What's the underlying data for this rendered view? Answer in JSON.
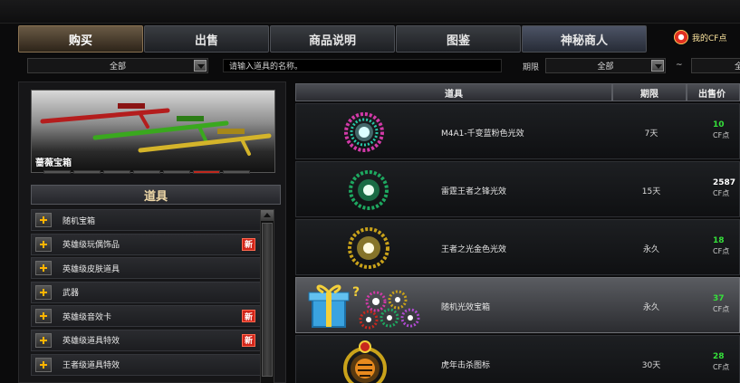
{
  "tabs": [
    {
      "label": "购买",
      "active": true
    },
    {
      "label": "出售",
      "active": false
    },
    {
      "label": "商品说明",
      "active": false
    },
    {
      "label": "图鉴",
      "active": false
    },
    {
      "label": "神秘商人",
      "active": false
    }
  ],
  "header": {
    "my_cf_label": "我的CF点"
  },
  "filter": {
    "category_value": "全部",
    "search_placeholder": "请输入道具的名称。",
    "period_label": "期限",
    "period_value": "全部",
    "tilde": "~",
    "price_value": "全"
  },
  "banner": {
    "label": "蔷薇宝箱",
    "page_count": 7,
    "active_page": 6
  },
  "sidebar": {
    "header": "道具",
    "items": [
      {
        "label": "随机宝箱",
        "new": false
      },
      {
        "label": "英雄级玩偶饰品",
        "new": true
      },
      {
        "label": "英雄级皮肤道具",
        "new": false
      },
      {
        "label": "武器",
        "new": false
      },
      {
        "label": "英雄级音效卡",
        "new": true
      },
      {
        "label": "英雄级道具特效",
        "new": true
      },
      {
        "label": "王者级道具特效",
        "new": false
      }
    ],
    "new_badge": "新"
  },
  "table": {
    "columns": [
      "道具",
      "期限",
      "出售价"
    ],
    "rows": [
      {
        "name": "M4A1-千变蓝粉色光效",
        "period": "7天",
        "price": "10",
        "unit": "CF点",
        "icon": "pink-teal-ring-effect-icon",
        "price_color": "#35e03a"
      },
      {
        "name": "雷霆王者之锋光效",
        "period": "15天",
        "price": "2587",
        "unit": "CF点",
        "icon": "green-ring-effect-icon",
        "price_color": "#ffffff"
      },
      {
        "name": "王者之光金色光效",
        "period": "永久",
        "price": "18",
        "unit": "CF点",
        "icon": "gold-ring-effect-icon",
        "price_color": "#35e03a"
      },
      {
        "name": "随机光效宝箱",
        "period": "永久",
        "price": "37",
        "unit": "CF点",
        "icon": "gift-box-effects-icon",
        "price_color": "#35e03a"
      },
      {
        "name": "虎年击杀图标",
        "period": "30天",
        "price": "28",
        "unit": "CF点",
        "icon": "tiger-emblem-icon",
        "price_color": "#35e03a"
      }
    ]
  }
}
